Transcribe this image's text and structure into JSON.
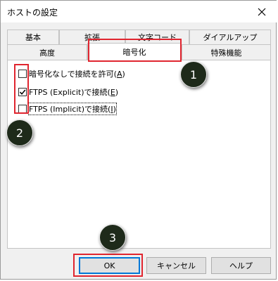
{
  "dialog": {
    "title": "ホストの設定"
  },
  "tabs": {
    "back_row": [
      "基本",
      "拡張",
      "文字コード",
      "ダイアルアップ"
    ],
    "front_row": [
      "高度",
      "暗号化",
      "特殊機能"
    ],
    "active": "暗号化"
  },
  "options": [
    {
      "label": "暗号化なしで接続を許可",
      "accel": "A",
      "checked": false
    },
    {
      "label": "FTPS (Explicit)で接続",
      "accel": "E",
      "checked": true
    },
    {
      "label": "FTPS (Implicit)で接続",
      "accel": "I",
      "checked": false
    }
  ],
  "buttons": {
    "ok": "OK",
    "cancel": "キャンセル",
    "help": "ヘルプ"
  },
  "annotations": {
    "marker_1": "1",
    "marker_2": "2",
    "marker_3": "3",
    "highlight_color": "#e0252f"
  },
  "colors": {
    "focus_border": "#0078d7",
    "marker_bg": "#1e2a1a"
  },
  "icons": [
    "close-icon",
    "checkmark-icon"
  ]
}
